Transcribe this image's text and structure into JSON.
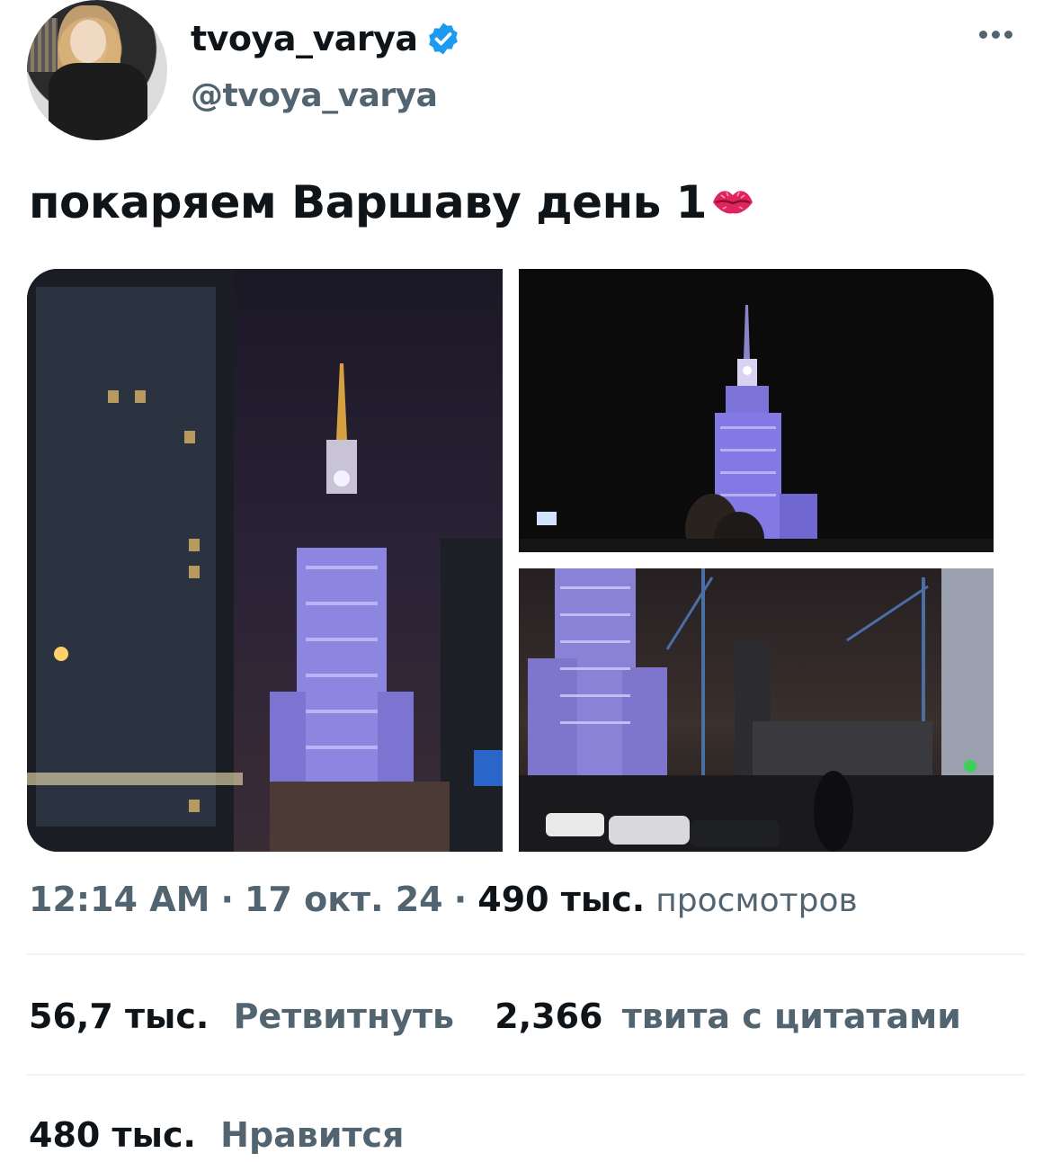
{
  "author": {
    "display_name": "tvoya_varya",
    "handle": "@tvoya_varya",
    "verified": true,
    "verified_color": "#1d9bf0"
  },
  "tweet": {
    "text": "покаряем Варшаву день 1",
    "emoji_icon": "kiss-mark-icon"
  },
  "media": [
    {
      "description_icon": "photo",
      "scene": "palace-street-night"
    },
    {
      "description_icon": "photo",
      "scene": "palace-selfie-night"
    },
    {
      "description_icon": "photo",
      "scene": "palace-construction-night"
    }
  ],
  "meta": {
    "time": "12:14 AM",
    "separator": "·",
    "date": "17 окт. 24",
    "views_count": "490 тыс.",
    "views_label": "просмотров"
  },
  "stats": {
    "retweets_count": "56,7 тыс.",
    "retweets_label": "Ретвитнуть",
    "quotes_count": "2,366",
    "quotes_label": "твита с цитатами",
    "likes_count": "480 тыс.",
    "likes_label": "Нравится"
  },
  "colors": {
    "text_primary": "#0f1419",
    "text_secondary": "#536471",
    "divider": "#eff3f4"
  }
}
